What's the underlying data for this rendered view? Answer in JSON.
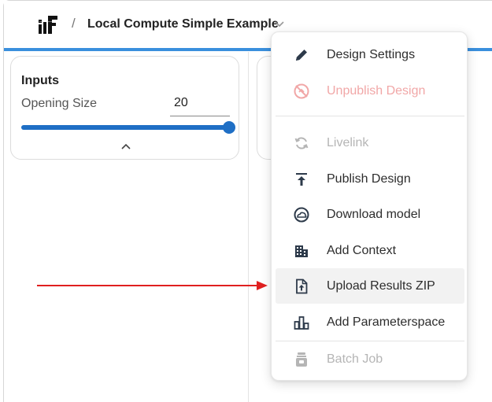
{
  "header": {
    "separator": "/",
    "title": "Local Compute Simple Example"
  },
  "inputs_panel": {
    "title": "Inputs",
    "parameter_label": "Opening Size",
    "parameter_value": "20",
    "slider_fraction": 1.0
  },
  "menu": {
    "items": [
      {
        "label": "Design Settings",
        "icon": "pencil-icon",
        "state": "enabled"
      },
      {
        "label": "Unpublish Design",
        "icon": "unpublish-icon",
        "state": "danger-disabled"
      },
      {
        "label": "Livelink",
        "icon": "sync-icon",
        "state": "disabled"
      },
      {
        "label": "Publish Design",
        "icon": "publish-upload-icon",
        "state": "enabled"
      },
      {
        "label": "Download model",
        "icon": "cloud-download-icon",
        "state": "enabled"
      },
      {
        "label": "Add Context",
        "icon": "buildings-icon",
        "state": "enabled"
      },
      {
        "label": "Upload Results ZIP",
        "icon": "file-upload-icon",
        "state": "highlighted"
      },
      {
        "label": "Add Parameterspace",
        "icon": "bar-chart-icon",
        "state": "enabled"
      },
      {
        "label": "Batch Job",
        "icon": "batch-icon",
        "state": "disabled"
      }
    ]
  },
  "colors": {
    "accent_blue": "#3a8fdd",
    "slider_blue": "#1f6fc5",
    "annotation_arrow": "#e02020",
    "danger_text": "#f1a7a7",
    "disabled_text": "#b5b5b5"
  }
}
